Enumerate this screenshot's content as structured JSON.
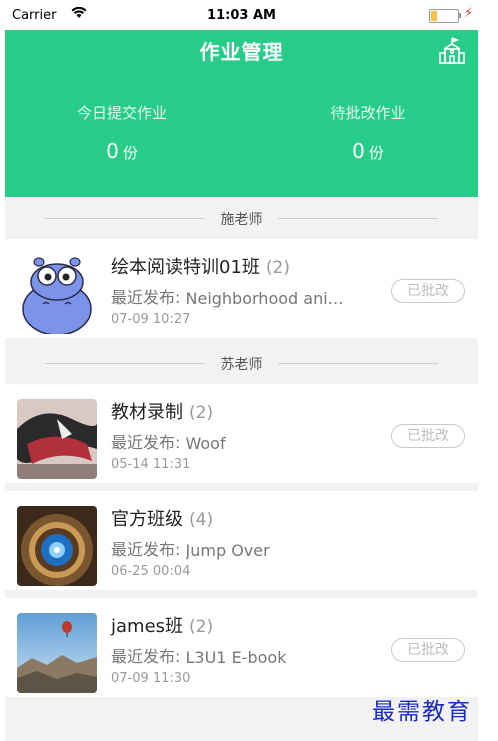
{
  "status_bar": {
    "carrier": "Carrier",
    "time": "11:03 AM"
  },
  "header": {
    "title": "作业管理",
    "today_label": "今日提交作业",
    "today_value": "0",
    "pending_label": "待批改作业",
    "pending_value": "0",
    "unit": "份"
  },
  "colors": {
    "accent": "#26cc88",
    "badge_border": "#c8c8c8",
    "watermark": "#1a2cbf"
  },
  "teachers": [
    {
      "name": "施老师",
      "classes": [
        {
          "name": "绘本阅读特训01班",
          "count": "(2)",
          "recent_label": "最近发布:",
          "recent": "Neighborhood animals",
          "time": "07-09 10:27",
          "badge": "已批改",
          "thumb_icon": "hippo-avatar-icon"
        }
      ]
    },
    {
      "name": "苏老师",
      "classes": [
        {
          "name": "教材录制",
          "count": "(2)",
          "recent_label": "最近发布:",
          "recent": "Woof",
          "time": "05-14 11:31",
          "badge": "已批改",
          "thumb_icon": "fabric-photo-icon"
        },
        {
          "name": "官方班级",
          "count": "(4)",
          "recent_label": "最近发布:",
          "recent": "Jump Over",
          "time": "06-25 00:04",
          "badge": "",
          "thumb_icon": "spiral-stair-photo-icon"
        },
        {
          "name": "james班",
          "count": "(2)",
          "recent_label": "最近发布:",
          "recent": "L3U1 E-book",
          "time": "07-09 11:30",
          "badge": "已批改",
          "thumb_icon": "balloon-photo-icon"
        }
      ]
    }
  ],
  "watermark": "最需教育"
}
